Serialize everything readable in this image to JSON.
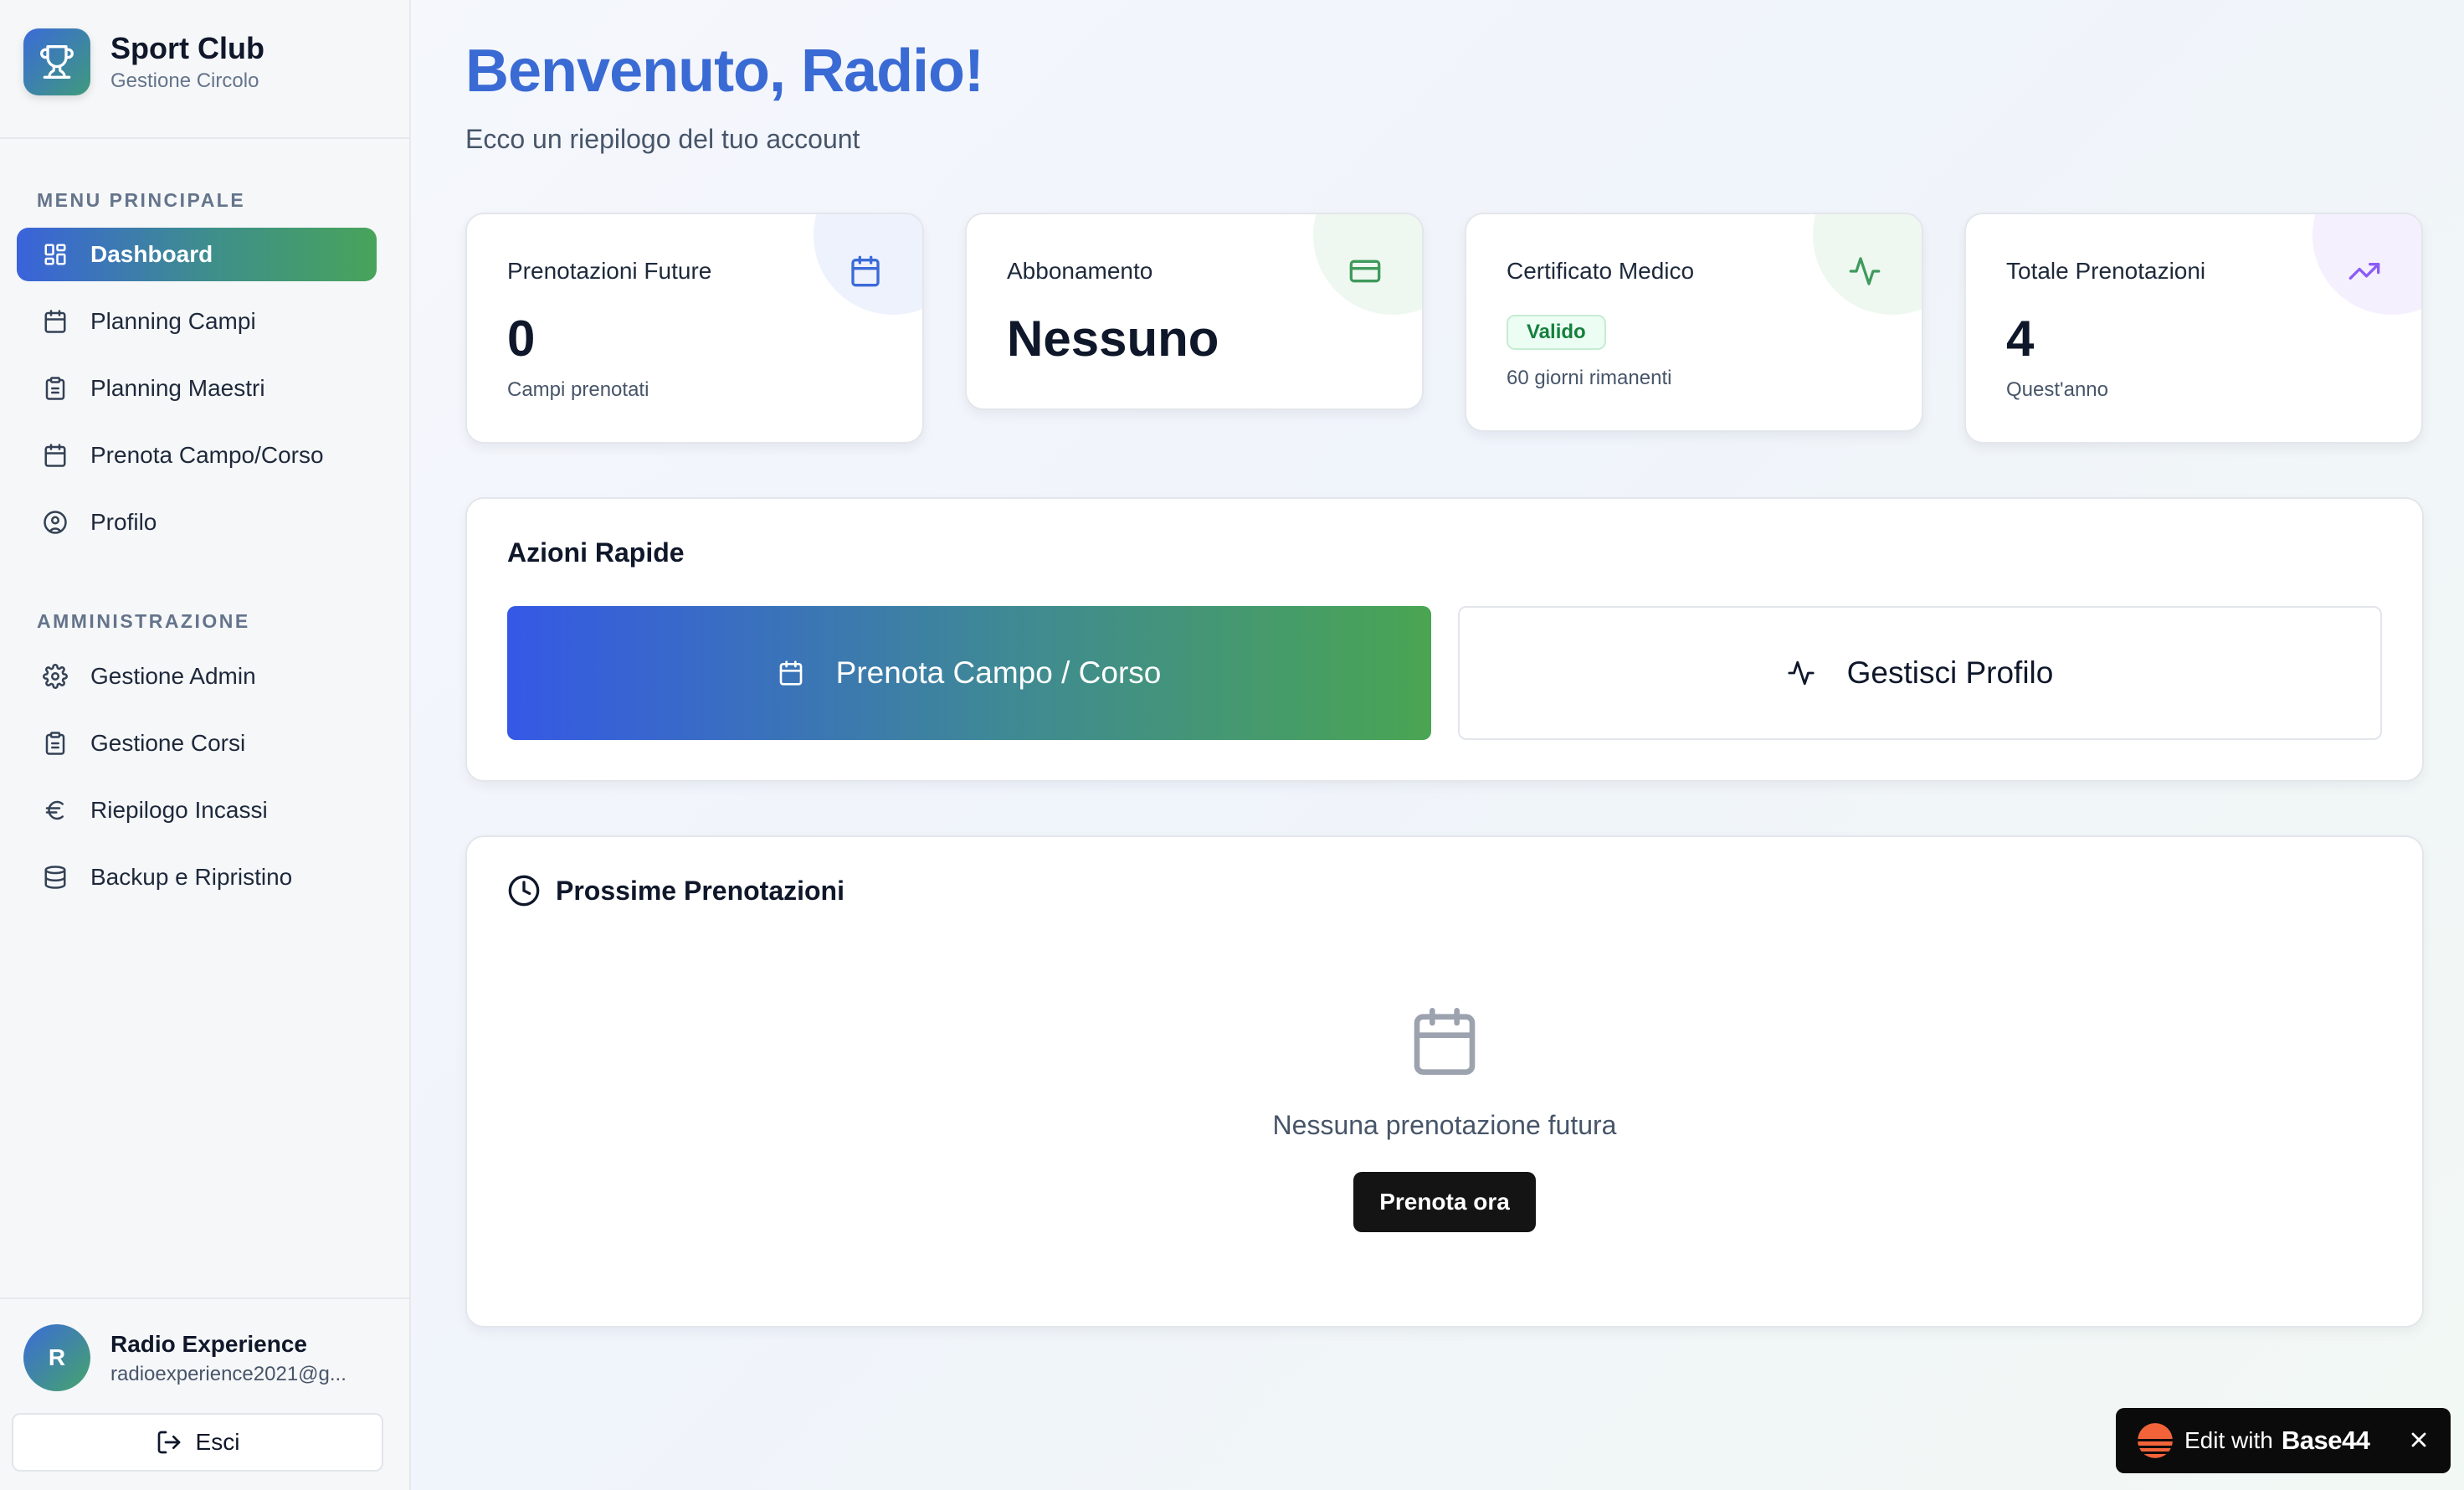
{
  "brand": {
    "title": "Sport Club",
    "subtitle": "Gestione Circolo"
  },
  "sidebar": {
    "main_label": "MENU PRINCIPALE",
    "main_items": [
      {
        "label": "Dashboard",
        "icon": "dashboard-grid-icon",
        "active": true
      },
      {
        "label": "Planning Campi",
        "icon": "calendar-icon"
      },
      {
        "label": "Planning Maestri",
        "icon": "clipboard-icon"
      },
      {
        "label": "Prenota Campo/Corso",
        "icon": "calendar-icon"
      },
      {
        "label": "Profilo",
        "icon": "user-circle-icon"
      }
    ],
    "admin_label": "AMMINISTRAZIONE",
    "admin_items": [
      {
        "label": "Gestione Admin",
        "icon": "gear-icon"
      },
      {
        "label": "Gestione Corsi",
        "icon": "clipboard-icon"
      },
      {
        "label": "Riepilogo Incassi",
        "icon": "euro-icon"
      },
      {
        "label": "Backup e Ripristino",
        "icon": "database-icon"
      }
    ]
  },
  "user": {
    "initial": "R",
    "name": "Radio Experience",
    "email": "radioexperience2021@g...",
    "logout_label": "Esci"
  },
  "header": {
    "title": "Benvenuto, Radio!",
    "subtitle": "Ecco un riepilogo del tuo account"
  },
  "stats": [
    {
      "label": "Prenotazioni Future",
      "value": "0",
      "note": "Campi prenotati",
      "icon": "calendar-icon",
      "color": "#3b6bd8"
    },
    {
      "label": "Abbonamento",
      "value": "Nessuno",
      "icon": "credit-card-icon",
      "color": "#3f9a5c"
    },
    {
      "label": "Certificato Medico",
      "badge": "Valido",
      "note": "60 giorni rimanenti",
      "icon": "activity-icon",
      "color": "#3f9a5c"
    },
    {
      "label": "Totale Prenotazioni",
      "value": "4",
      "note": "Quest'anno",
      "icon": "trending-up-icon",
      "color": "#8b5cf6"
    }
  ],
  "quick_actions": {
    "title": "Azioni Rapide",
    "primary_label": "Prenota Campo / Corso",
    "secondary_label": "Gestisci Profilo"
  },
  "bookings": {
    "title": "Prossime Prenotazioni",
    "empty_text": "Nessuna prenotazione futura",
    "cta_label": "Prenota ora"
  },
  "badge44": {
    "prefix": "Edit with",
    "brand": "Base44"
  }
}
